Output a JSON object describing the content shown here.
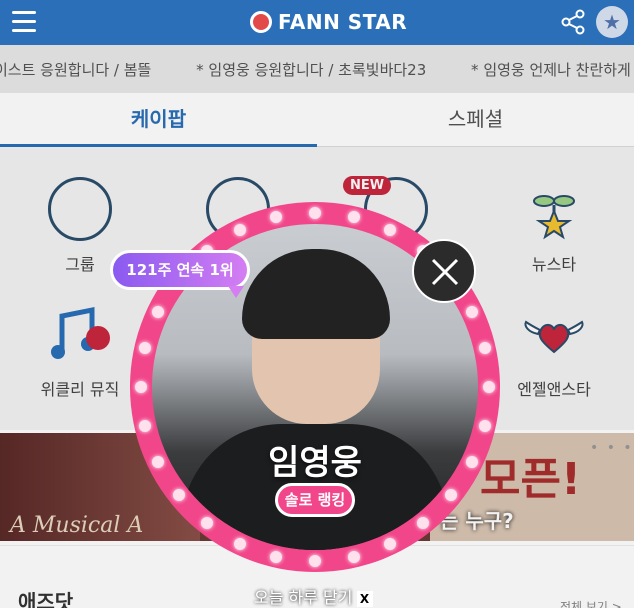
{
  "header": {
    "logo_text": "FANN STAR"
  },
  "ticker": [
    "이스트 응원합니다 / 봄뜰",
    "* 임영웅 응원합니다 / 초록빛바다23",
    "* 임영웅 언제나 찬란하게 빛나길 응"
  ],
  "tabs": [
    {
      "label": "케이팝"
    },
    {
      "label": "스페셜"
    }
  ],
  "grid": {
    "items": [
      {
        "label": "그룹",
        "icon": "group-icon"
      },
      {
        "label": "",
        "icon": "person-star-icon"
      },
      {
        "label": "",
        "icon": "globe-star-icon"
      },
      {
        "label": "뉴스타",
        "icon": "sprout-star-icon"
      },
      {
        "label": "위클리 뮤직",
        "icon": "music-chart-icon"
      },
      {
        "label": "엔젤앤스타",
        "icon": "winged-heart-icon"
      }
    ],
    "new_badge": "NEW"
  },
  "banner": {
    "big_text": "모픈!",
    "sub_text": "는 누구?",
    "left_text": "A Musical A"
  },
  "section": {
    "title": "애즈닷",
    "see_all": "전체 보기 >"
  },
  "popup": {
    "streak": "121주 연속 1위",
    "name": "임영웅",
    "solo_label": "솔로 랭킹",
    "today_close": "오늘 하루 닫기",
    "close_x": "X"
  },
  "colors": {
    "brand_blue": "#2a6fb8",
    "pink": "#f2468a"
  }
}
